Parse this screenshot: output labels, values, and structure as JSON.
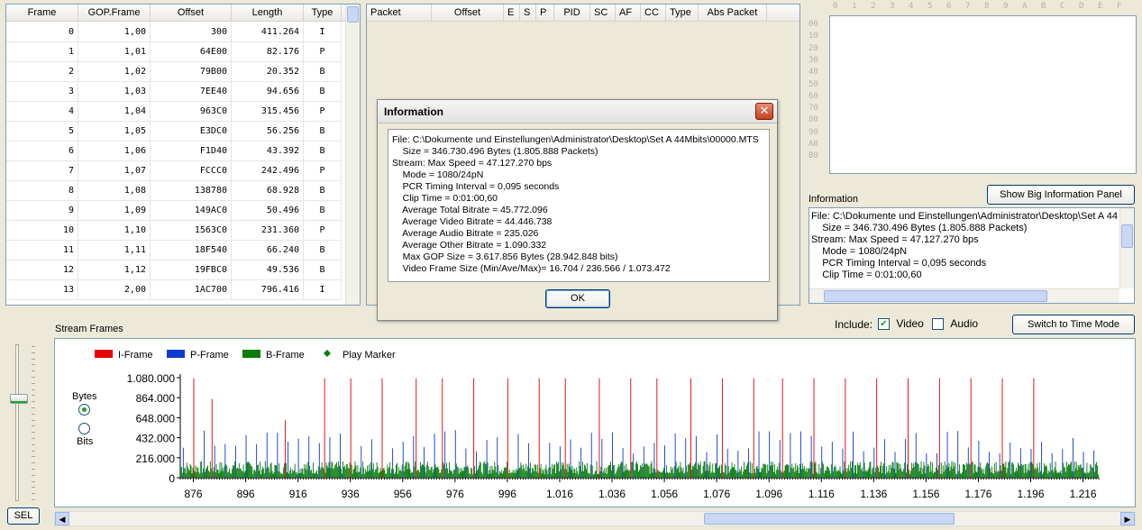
{
  "frames_table": {
    "columns": [
      "Frame",
      "GOP.Frame",
      "Offset",
      "Length",
      "Type"
    ],
    "rows": [
      [
        "0",
        "1,00",
        "300",
        "411.264",
        "I"
      ],
      [
        "1",
        "1,01",
        "64E00",
        "82.176",
        "P"
      ],
      [
        "2",
        "1,02",
        "79B00",
        "20.352",
        "B"
      ],
      [
        "3",
        "1,03",
        "7EE40",
        "94.656",
        "B"
      ],
      [
        "4",
        "1,04",
        "963C0",
        "315.456",
        "P"
      ],
      [
        "5",
        "1,05",
        "E3DC0",
        "56.256",
        "B"
      ],
      [
        "6",
        "1,06",
        "F1D40",
        "43.392",
        "B"
      ],
      [
        "7",
        "1,07",
        "FCCC0",
        "242.496",
        "P"
      ],
      [
        "8",
        "1,08",
        "138780",
        "68.928",
        "B"
      ],
      [
        "9",
        "1,09",
        "149AC0",
        "50.496",
        "B"
      ],
      [
        "10",
        "1,10",
        "1563C0",
        "231.360",
        "P"
      ],
      [
        "11",
        "1,11",
        "18F540",
        "66.240",
        "B"
      ],
      [
        "12",
        "1,12",
        "19FBC0",
        "49.536",
        "B"
      ],
      [
        "13",
        "2,00",
        "1AC700",
        "796.416",
        "I"
      ]
    ]
  },
  "packets_table": {
    "columns": [
      "Packet",
      "Offset",
      "E",
      "S",
      "P",
      "PID",
      "SC",
      "AF",
      "CC",
      "Type",
      "Abs Packet"
    ]
  },
  "hex_view": {
    "columns": [
      "0",
      "1",
      "2",
      "3",
      "4",
      "5",
      "6",
      "7",
      "8",
      "9",
      "A",
      "B",
      "C",
      "D",
      "E",
      "F"
    ],
    "rows": [
      "00",
      "10",
      "20",
      "30",
      "40",
      "50",
      "60",
      "70",
      "80",
      "90",
      "A0",
      "B0"
    ]
  },
  "info_panel": {
    "label": "Information",
    "big_button": "Show Big Information Panel",
    "lines": [
      "File: C:\\Dokumente und Einstellungen\\Administrator\\Desktop\\Set A 44Mbits\\00000.MTS",
      "    Size = 346.730.496 Bytes (1.805.888 Packets)",
      "Stream: Max Speed = 47.127.270 bps",
      "    Mode = 1080/24pN",
      "    PCR Timing Interval = 0,095 seconds",
      "    Clip Time = 0:01:00,60"
    ]
  },
  "dialog": {
    "title": "Information",
    "close": "✕",
    "ok": "OK",
    "lines": [
      "File: C:\\Dokumente und Einstellungen\\Administrator\\Desktop\\Set A 44Mbits\\00000.MTS",
      "    Size = 346.730.496 Bytes (1.805.888 Packets)",
      "Stream: Max Speed = 47.127.270 bps",
      "    Mode = 1080/24pN",
      "    PCR Timing Interval = 0,095 seconds",
      "    Clip Time = 0:01:00,60",
      "    Average Total Bitrate = 45.772.096",
      "    Average Video Bitrate = 44.446.738",
      "    Average Audio Bitrate = 235.026",
      "    Average Other Bitrate = 1.090.332",
      "    Max GOP Size = 3.617.856 Bytes (28.942.848 bits)",
      "    Video Frame Size (Min/Ave/Max)= 16.704 / 236.566 / 1.073.472"
    ]
  },
  "stream_frames": {
    "label": "Stream Frames",
    "include_label": "Include:",
    "video_label": "Video",
    "video_checked": true,
    "audio_label": "Audio",
    "audio_checked": false,
    "switch_button": "Switch to Time Mode",
    "units_bytes": "Bytes",
    "units_bits": "Bits",
    "sel_button": "SEL"
  },
  "chart_data": {
    "type": "bar",
    "legend": [
      {
        "name": "I-Frame",
        "color": "#e60000"
      },
      {
        "name": "P-Frame",
        "color": "#0a3cd2"
      },
      {
        "name": "B-Frame",
        "color": "#0a7d0a"
      },
      {
        "name": "Play Marker",
        "color": "#0a7d0a"
      }
    ],
    "yticks": [
      "1.080.000",
      "864.000",
      "648.000",
      "432.000",
      "216.000",
      "0"
    ],
    "ylim": [
      0,
      1080000
    ],
    "xticks": [
      "876",
      "896",
      "916",
      "936",
      "956",
      "976",
      "996",
      "1.016",
      "1.036",
      "1.056",
      "1.076",
      "1.096",
      "1.116",
      "1.136",
      "1.156",
      "1.176",
      "1.196",
      "1.216"
    ],
    "xlim": [
      871,
      1222
    ],
    "i_frames": [
      [
        876,
        1073000
      ],
      [
        883,
        850000
      ],
      [
        911,
        620000
      ],
      [
        926,
        1073000
      ],
      [
        936,
        1073000
      ],
      [
        948,
        1073000
      ],
      [
        961,
        1073000
      ],
      [
        971,
        1073000
      ],
      [
        983,
        1073000
      ],
      [
        996,
        1073000
      ],
      [
        1008,
        1073000
      ],
      [
        1018,
        1073000
      ],
      [
        1031,
        1073000
      ],
      [
        1043,
        1073000
      ],
      [
        1053,
        1073000
      ],
      [
        1066,
        1073000
      ],
      [
        1078,
        1073000
      ],
      [
        1090,
        1073000
      ],
      [
        1101,
        1073000
      ],
      [
        1113,
        1073000
      ],
      [
        1125,
        1073000
      ],
      [
        1137,
        1073000
      ],
      [
        1149,
        1073000
      ],
      [
        1161,
        1073000
      ],
      [
        1173,
        1073000
      ],
      [
        1185,
        1073000
      ],
      [
        1197,
        1073000
      ]
    ],
    "p_frames_max": 520000,
    "b_frames_max": 180000
  }
}
